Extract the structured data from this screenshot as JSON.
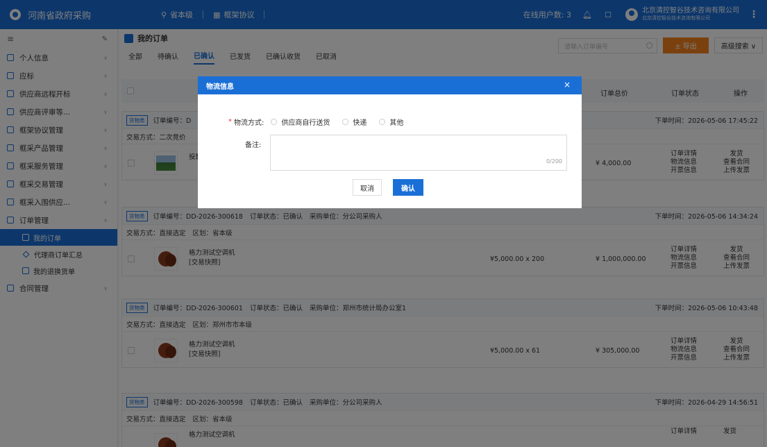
{
  "app": {
    "title": "河南省政府采购",
    "nav": [
      {
        "icon": "location-icon",
        "label": "省本级"
      },
      {
        "icon": "grid-icon",
        "label": "框架协议"
      }
    ],
    "online_label": "在线用户数: 3",
    "company_name": "北京清控智谷技术咨询有限公司",
    "company_sub": "北京清控智谷技术咨询有限公司",
    "brand_color": "#1a6fd6"
  },
  "sidebar": {
    "items": [
      {
        "label": "个人信息",
        "icon": "user-icon"
      },
      {
        "label": "应标",
        "icon": "bid-icon"
      },
      {
        "label": "供应商远程开标",
        "icon": "remote-icon"
      },
      {
        "label": "供应商评审等...",
        "icon": "review-icon"
      },
      {
        "label": "框架协议管理",
        "icon": "agreement-icon"
      },
      {
        "label": "框采产品管理",
        "icon": "product-icon"
      },
      {
        "label": "框采服务管理",
        "icon": "service-icon"
      },
      {
        "label": "框采交易管理",
        "icon": "trade-icon"
      },
      {
        "label": "框采入围供应...",
        "icon": "supplier-icon"
      },
      {
        "label": "订单管理",
        "icon": "order-icon"
      }
    ],
    "subitems": [
      {
        "label": "我的订单",
        "active": true
      },
      {
        "label": "代理商订单汇总",
        "active": false
      },
      {
        "label": "我的退换货单",
        "active": false
      }
    ],
    "last_item": {
      "label": "合同管理",
      "icon": "contract-icon"
    }
  },
  "main": {
    "title": "我的订单",
    "search_placeholder": "请输入订单编号",
    "export_label": "± 导出",
    "advanced_label": "高级搜索 ∨",
    "tabs": [
      "全部",
      "待确认",
      "已确认",
      "已发货",
      "已确认收货",
      "已取消"
    ],
    "active_tab": 2,
    "columns": {
      "total": "订单总价",
      "status": "订单状态",
      "action": "操作"
    }
  },
  "orders": [
    {
      "tag": "货物类",
      "number": "订单编号：D",
      "time": "下单时间：2026-05-06 17:45:22",
      "meta": "交易方式：二次竞价",
      "product": "投影",
      "sub": "",
      "price": "",
      "total": "¥ 4,000.00",
      "image": "landscape"
    },
    {
      "tag": "货物类",
      "number": "订单编号：DD-2026-300618",
      "status": "订单状态：已确认",
      "buyer": "采购单位：分公司采购人",
      "time": "下单时间：2026-05-06 14:34:24",
      "meta": "交易方式：直接选定",
      "region": "区划：省本级",
      "product": "格力测试空调机",
      "sub": "[交易快照]",
      "price": "¥5,000.00 x 200",
      "total": "¥ 1,000,000.00",
      "image": "ball"
    },
    {
      "tag": "货物类",
      "number": "订单编号：DD-2026-300601",
      "status": "订单状态：已确认",
      "buyer": "采购单位：郑州市统计局办公室1",
      "time": "下单时间：2026-05-06 10:43:48",
      "meta": "交易方式：直接选定",
      "region": "区划：郑州市市本级",
      "product": "格力测试空调机",
      "sub": "[交易快照]",
      "price": "¥5,000.00 x 61",
      "total": "¥ 305,000.00",
      "image": "ball"
    },
    {
      "tag": "货物类",
      "number": "订单编号：DD-2026-300598",
      "status": "订单状态：已确认",
      "buyer": "采购单位：分公司采购人",
      "time": "下单时间：2026-04-29 14:56:51",
      "meta": "交易方式：直接选定",
      "region": "区划：省本级",
      "product": "格力测试空调机",
      "sub": "",
      "price": "",
      "total": "",
      "image": "ball"
    }
  ],
  "actions": {
    "detail": "订单详情",
    "logistics": "物流信息",
    "invoice_info": "开票信息",
    "ship": "发货",
    "contract": "查看合同",
    "upload": "上传发票"
  },
  "modal": {
    "title": "物流信息",
    "close": "×",
    "method_label": "物流方式:",
    "options": [
      "供应商自行送货",
      "快递",
      "其他"
    ],
    "remark_label": "备注:",
    "counter": "0/200",
    "cancel": "取消",
    "confirm": "确认"
  }
}
